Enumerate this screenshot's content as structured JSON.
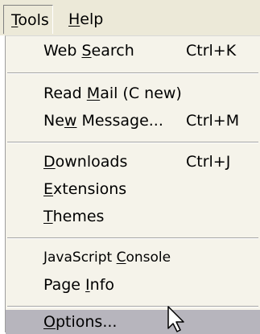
{
  "menubar": {
    "items": [
      {
        "id": "tools",
        "pre": "",
        "accel": "T",
        "post": "ools"
      },
      {
        "id": "help",
        "pre": "",
        "accel": "H",
        "post": "elp"
      }
    ]
  },
  "menu": {
    "items": [
      {
        "pre": "Web ",
        "accel": "S",
        "post": "earch",
        "shortcut": "Ctrl+K"
      },
      {
        "pre": "Read ",
        "accel": "M",
        "post": "ail (C new)",
        "shortcut": ""
      },
      {
        "pre": "Ne",
        "accel": "w",
        "post": " Message...",
        "shortcut": "Ctrl+M"
      },
      {
        "pre": "",
        "accel": "D",
        "post": "ownloads",
        "shortcut": "Ctrl+J"
      },
      {
        "pre": "",
        "accel": "E",
        "post": "xtensions",
        "shortcut": ""
      },
      {
        "pre": "",
        "accel": "T",
        "post": "hemes",
        "shortcut": ""
      },
      {
        "pre": "JavaScript ",
        "accel": "C",
        "post": "onsole",
        "shortcut": ""
      },
      {
        "pre": "Page ",
        "accel": "I",
        "post": "nfo",
        "shortcut": ""
      },
      {
        "pre": "",
        "accel": "O",
        "post": "ptions...",
        "shortcut": ""
      }
    ]
  },
  "colors": {
    "menubar_bg": "#ece9d8",
    "menu_bg": "#f5f3ea",
    "highlight_bg": "#b7b5bd",
    "separator": "#a6a6a6",
    "text": "#000000"
  },
  "cursor": {
    "icon": "mouse-pointer-icon"
  }
}
